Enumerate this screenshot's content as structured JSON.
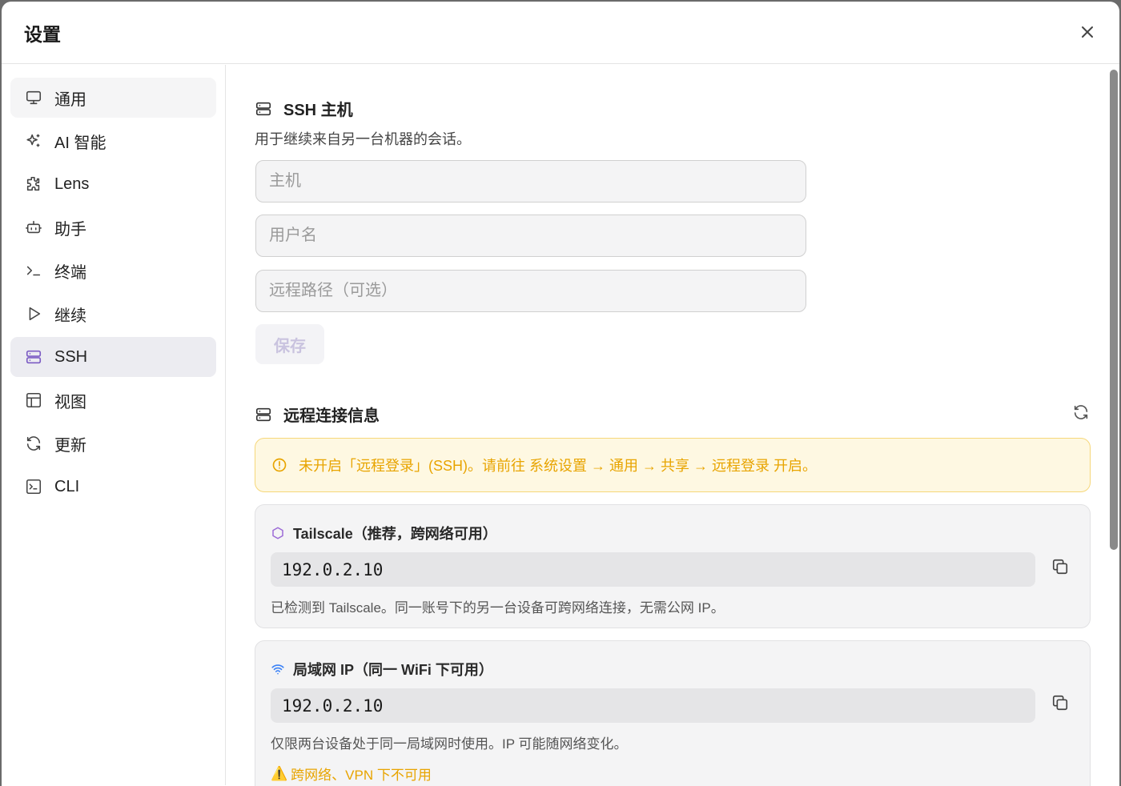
{
  "dialog": {
    "title": "设置"
  },
  "sidebar": {
    "items": [
      {
        "label": "通用",
        "icon": "monitor-icon"
      },
      {
        "label": "AI 智能",
        "icon": "sparkles-icon"
      },
      {
        "label": "Lens",
        "icon": "puzzle-icon"
      },
      {
        "label": "助手",
        "icon": "bot-icon"
      },
      {
        "label": "终端",
        "icon": "terminal-icon"
      },
      {
        "label": "继续",
        "icon": "play-icon"
      },
      {
        "label": "SSH",
        "icon": "server-icon"
      },
      {
        "label": "视图",
        "icon": "layout-icon"
      },
      {
        "label": "更新",
        "icon": "refresh-icon"
      },
      {
        "label": "CLI",
        "icon": "terminal-square-icon"
      }
    ],
    "active_label": "SSH"
  },
  "ssh_host": {
    "title": "SSH 主机",
    "description": "用于继续来自另一台机器的会话。",
    "host_placeholder": "主机",
    "username_placeholder": "用户名",
    "remote_path_placeholder": "远程路径（可选）",
    "save_label": "保存"
  },
  "remote_info": {
    "title": "远程连接信息",
    "warning": "未开启「远程登录」(SSH)。请前往 系统设置 → 通用 → 共享 → 远程登录 开启。",
    "tailscale": {
      "title": "Tailscale（推荐，跨网络可用）",
      "ip": "192.0.2.10",
      "note": "已检测到 Tailscale。同一账号下的另一台设备可跨网络连接，无需公网 IP。"
    },
    "lan": {
      "title": "局域网 IP（同一 WiFi 下可用）",
      "ip": "192.0.2.10",
      "note": "仅限两台设备处于同一局域网时使用。IP 可能随网络变化。",
      "warning": "跨网络、VPN 下不可用"
    }
  },
  "colors": {
    "accent": "#7c5cc4",
    "warning": "#e8a400",
    "wifi": "#3b82f6"
  }
}
